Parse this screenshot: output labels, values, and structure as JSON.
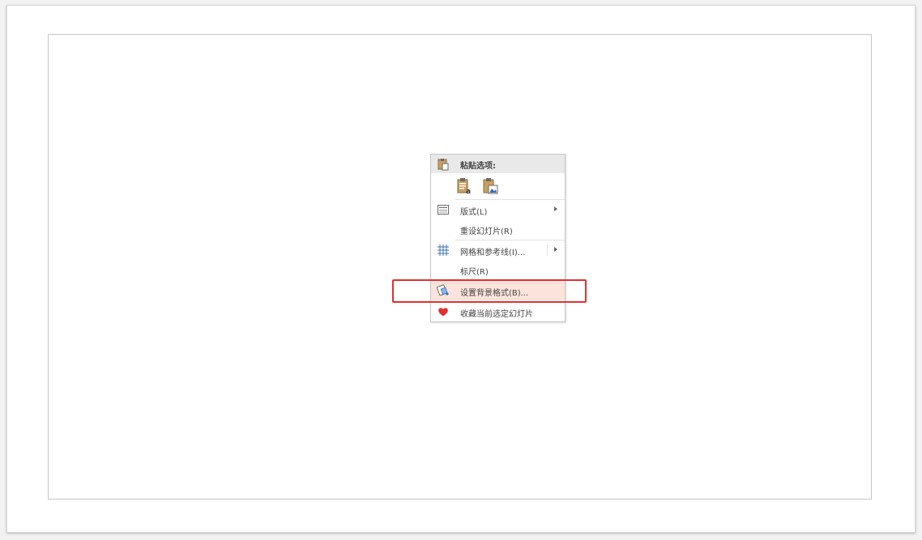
{
  "context_menu": {
    "paste_header": "粘贴选项:",
    "paste_options": [
      {
        "name": "keep-text-only",
        "icon": "paste-text-icon"
      },
      {
        "name": "picture",
        "icon": "paste-picture-icon"
      }
    ],
    "items": [
      {
        "label": "版式(L)",
        "icon": "layout-icon",
        "submenu": true
      },
      {
        "label": "重设幻灯片(R)",
        "icon": "",
        "submenu": false
      },
      {
        "label": "网格和参考线(I)...",
        "icon": "grid-icon",
        "submenu": true
      },
      {
        "label": "标尺(R)",
        "icon": "",
        "submenu": false
      },
      {
        "label": "设置背景格式(B)...",
        "icon": "paint-bucket-icon",
        "submenu": false
      },
      {
        "label": "收藏当前选定幻灯片",
        "icon": "heart-icon",
        "submenu": false
      }
    ]
  },
  "colors": {
    "highlight_border": "#e0312d",
    "hover_background": "#fce4dd",
    "heart": "#e0312d",
    "grid": "#3a6fb5"
  }
}
